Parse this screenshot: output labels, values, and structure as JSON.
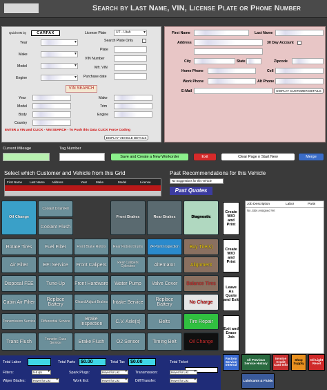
{
  "header": {
    "title": "Search by Last Name, VIN, License Plate or Phone Number"
  },
  "vehicle": {
    "quickvin_label": "QuickVIN by",
    "carfax": "CARFAX",
    "year_label": "Year",
    "make_label": "Make",
    "model_label": "Model",
    "engine_label": "Engine",
    "license_plate_label": "License Plate",
    "license_plate_state": "UT - Utah",
    "search_plate_only_label": "Search Plate Only",
    "plate_label": "Plate",
    "vin_number_label": "VIN Number",
    "mfr_vin_label": "Mfr. VIN",
    "purchase_date_label": "Purchase date",
    "vin_search_label": "VIN SEARCH",
    "year2_label": "Year",
    "make2_label": "Make",
    "model2_label": "Model",
    "trim_label": "Trim",
    "body_label": "Body",
    "engine2_label": "Engine",
    "country_label": "Country",
    "enter_vin_msg": "ENTER a VIN and CLICK - VIN SEARCH - To Push this Data CLICK Force Coding",
    "display_vehicle_details": "DISPLAY VEHICLE DETAILS"
  },
  "customer": {
    "first_name_label": "First Name",
    "last_name_label": "Last Name",
    "address_label": "Address",
    "thirty_day_label": "30 Day Account",
    "city_label": "City",
    "state_label": "State",
    "zipcode_label": "Zipcode",
    "home_phone_label": "Home Phone",
    "cell_label": "Cell",
    "work_phone_label": "Work Phone",
    "alt_phone_label": "Alt Phone",
    "email_label": "E-Mail",
    "display_customer_details": "DISPLAY CUSTOMER DETAILS"
  },
  "workorder": {
    "current_mileage_label": "Current Mileage",
    "tag_number_label": "Tag Number",
    "save_create_label": "Save and Create a New Workorder",
    "exit_label": "Exit",
    "clear_page_label": "Clear Page n Start New",
    "merge_label": "Merge"
  },
  "grid": {
    "title": "Select which Customer and Vehicle from this Grid",
    "columns": [
      "First Name",
      "Last Name",
      "Address",
      "Year",
      "Make",
      "Model",
      "License"
    ]
  },
  "recommendations": {
    "title": "Past Recommendations for this Vehicle",
    "no_suggestions": "No Suggestions for this Vehicle",
    "past_quotes": "Past Quotes"
  },
  "services": [
    [
      "Oil Change",
      "Coolant Drain/Fill",
      "Coolant Flush",
      "Front Brakes",
      "Rear Brakes",
      "Diagnostic"
    ],
    [
      "Rotate Tires",
      "Fuel Filter",
      "Front Brake Rotors",
      "Rear Rotors Drums",
      "24 Point Inspection",
      "Buy Tire(s)"
    ],
    [
      "Air Filter",
      "EFI Service",
      "Front Calipers",
      "Rear Calipers Cylinders",
      "Alternator",
      "Alignment"
    ],
    [
      "Disposal FEE",
      "Tune-Up",
      "Front Hardware",
      "Water Pump",
      "Valve Cover",
      "Balance Tires"
    ],
    [
      "Cabin Air Filter",
      "Replace Battery",
      "Clean&Adjust Brakes",
      "Intake Service",
      "Replace Battery",
      "No Charge"
    ],
    [
      "Transmission Service",
      "Differential Service",
      "Brake Inspection",
      "C.V. Axle(s)",
      "Belts",
      "Tire Repair"
    ],
    [
      "Trans Flush",
      "Transfer Case Service",
      "Brake Flush",
      "O2 Sensor",
      "Timing Belt",
      "Oil Change"
    ]
  ],
  "side_buttons": {
    "create1": "Create W/O and Print",
    "create2": "Create W/O and Print",
    "leave_quote": "Leave As Quote and Exit",
    "exit_erase": "Exit and Erase Job"
  },
  "job_table": {
    "headers": [
      "Job Description",
      "Labor",
      "Parts"
    ],
    "no_jobs": "No Jobs Assigned Yet"
  },
  "totals": {
    "total_labor_label": "Total Labor",
    "total_parts_label": "Total Parts",
    "total_parts_value": "$0.00",
    "total_tax_label": "Total Tax",
    "total_tax_value": "$0.00",
    "total_ticket_label": "Total Ticket",
    "filters_label": "Filters:",
    "filters_value": "5-5 qts",
    "spark_plugs_label": "Spark Plugs:",
    "transmission_label": "Transmission:",
    "wiper_blades_label": "Wiper Blades:",
    "work_ext_label": "Work Ext:",
    "diff_transfer_label": "Diff/Transfer:",
    "hover_for_list": "Hover for List"
  },
  "quick_buttons": [
    "Factory Service Interval",
    "All Previous Service History",
    "Invoice Credit Card Info",
    "Shop Supply",
    "Oil Light Reset",
    "Lubricants & Fluids"
  ]
}
